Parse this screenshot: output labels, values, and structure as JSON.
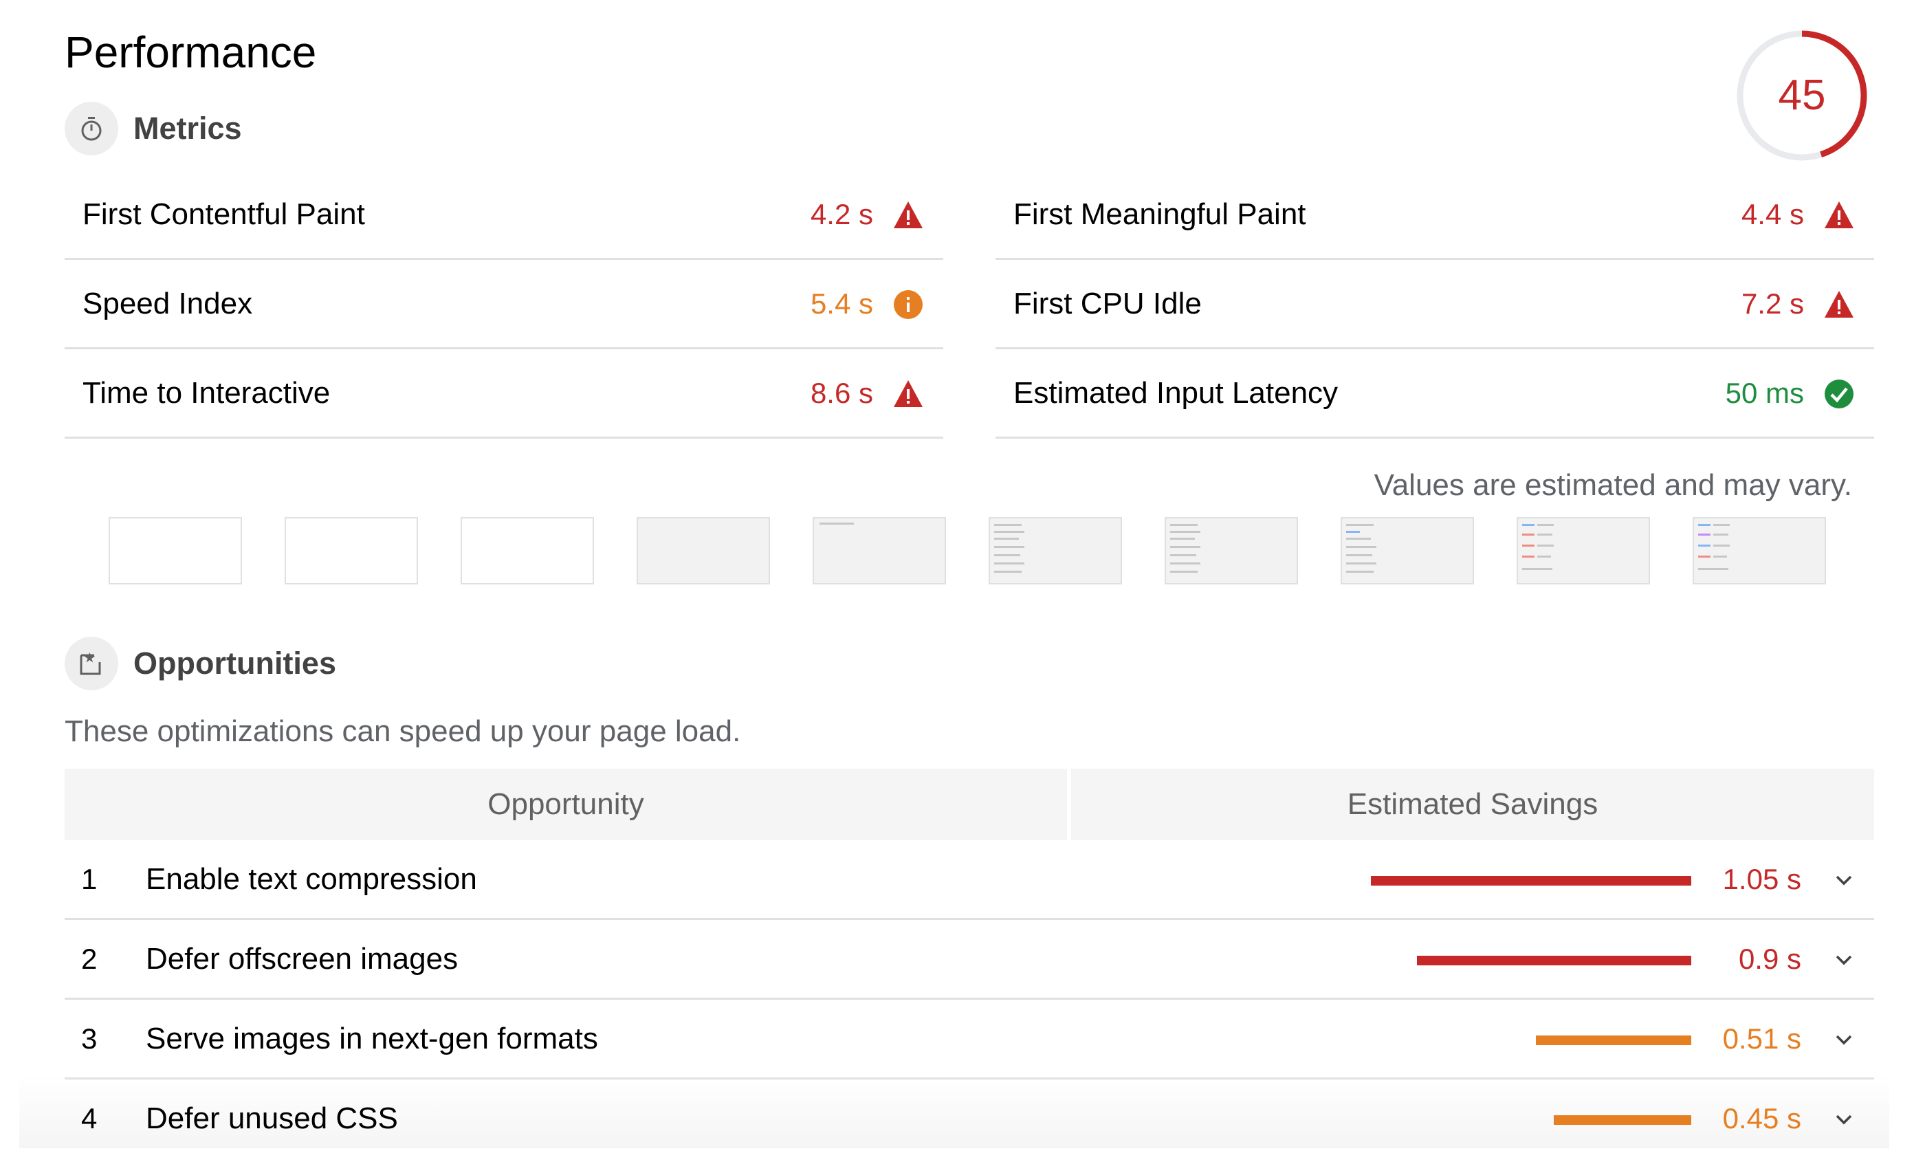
{
  "header": {
    "title": "Performance"
  },
  "score": {
    "value": "45",
    "fraction": 0.45,
    "color": "#c62828",
    "track_color": "#e8eaed"
  },
  "sections": {
    "metrics": {
      "label": "Metrics",
      "icon": "stopwatch-icon"
    },
    "opportunities": {
      "label": "Opportunities",
      "icon": "opportunity-icon",
      "description": "These optimizations can speed up your page load."
    }
  },
  "metrics": [
    {
      "name": "First Contentful Paint",
      "value": "4.2 s",
      "status": "fail",
      "icon": "warning-triangle-icon",
      "color": "#c62828"
    },
    {
      "name": "First Meaningful Paint",
      "value": "4.4 s",
      "status": "fail",
      "icon": "warning-triangle-icon",
      "color": "#c62828"
    },
    {
      "name": "Speed Index",
      "value": "5.4 s",
      "status": "average",
      "icon": "info-circle-icon",
      "color": "#e67e22"
    },
    {
      "name": "First CPU Idle",
      "value": "7.2 s",
      "status": "fail",
      "icon": "warning-triangle-icon",
      "color": "#c62828"
    },
    {
      "name": "Time to Interactive",
      "value": "8.6 s",
      "status": "fail",
      "icon": "warning-triangle-icon",
      "color": "#c62828"
    },
    {
      "name": "Estimated Input Latency",
      "value": "50 ms",
      "status": "pass",
      "icon": "check-circle-icon",
      "color": "#1e8e3e"
    }
  ],
  "estimate_note": "Values are estimated and may vary.",
  "filmstrip": {
    "frame_count": 10,
    "frames": [
      "blank",
      "blank",
      "blank",
      "gray",
      "gray-text",
      "content",
      "content",
      "content",
      "content-colored",
      "content-colored"
    ]
  },
  "table": {
    "headers": {
      "opportunity": "Opportunity",
      "savings": "Estimated Savings"
    },
    "rows": [
      {
        "num": "1",
        "title": "Enable text compression",
        "savings": "1.05 s",
        "savings_value": 1.05,
        "color": "#c62828"
      },
      {
        "num": "2",
        "title": "Defer offscreen images",
        "savings": "0.9 s",
        "savings_value": 0.9,
        "color": "#c62828"
      },
      {
        "num": "3",
        "title": "Serve images in next-gen formats",
        "savings": "0.51 s",
        "savings_value": 0.51,
        "color": "#e67e22"
      },
      {
        "num": "4",
        "title": "Defer unused CSS",
        "savings": "0.45 s",
        "savings_value": 0.45,
        "color": "#e67e22"
      }
    ]
  }
}
